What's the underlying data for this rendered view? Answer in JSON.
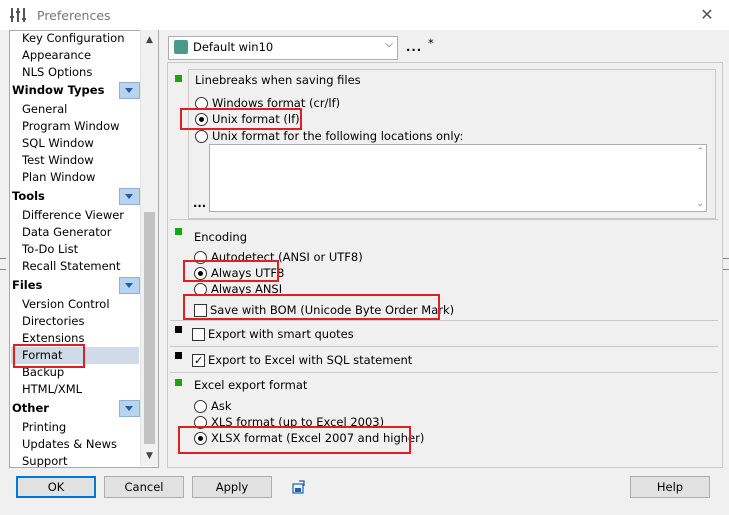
{
  "window": {
    "title": "Preferences",
    "close_icon": "close-icon"
  },
  "tree": {
    "items_top": [
      "Key Configuration",
      "Appearance",
      "NLS Options"
    ],
    "groups": [
      {
        "label": "Window Types",
        "items": [
          "General",
          "Program Window",
          "SQL Window",
          "Test Window",
          "Plan Window"
        ]
      },
      {
        "label": "Tools",
        "items": [
          "Difference Viewer",
          "Data Generator",
          "To-Do List",
          "Recall Statement"
        ]
      },
      {
        "label": "Files",
        "items": [
          "Version Control",
          "Directories",
          "Extensions",
          "Format",
          "Backup",
          "HTML/XML"
        ]
      },
      {
        "label": "Other",
        "items": [
          "Printing",
          "Updates & News",
          "Support"
        ]
      }
    ],
    "selected": "Format"
  },
  "toolbar": {
    "profile_value": "Default win10",
    "dots_label": "...",
    "modified_marker": "*"
  },
  "linebreaks": {
    "title": "Linebreaks when saving files",
    "options": [
      "Windows format (cr/lf)",
      "Unix format (lf)",
      "Unix format for the following locations only:"
    ],
    "selected": 1,
    "locations_button": "..."
  },
  "encoding": {
    "title": "Encoding",
    "options": [
      "Autodetect (ANSI or UTF8)",
      "Always UTF8",
      "Always ANSI"
    ],
    "selected": 1,
    "bom_label": "Save with BOM (Unicode Byte Order Mark)",
    "bom_checked": false
  },
  "smart_quotes": {
    "label": "Export with smart quotes",
    "checked": false
  },
  "excel_sql": {
    "label": "Export to Excel with SQL statement",
    "checked": true
  },
  "excel_format": {
    "title": "Excel export format",
    "options": [
      "Ask",
      "XLS format (up to Excel 2003)",
      "XLSX format (Excel 2007 and higher)"
    ],
    "selected": 2
  },
  "buttons": {
    "ok": "OK",
    "cancel": "Cancel",
    "apply": "Apply",
    "help": "Help"
  },
  "colors": {
    "highlight": "#e02020",
    "marker_green": "#1aa31a",
    "marker_black": "#000000",
    "selection": "#cfdbe8"
  }
}
